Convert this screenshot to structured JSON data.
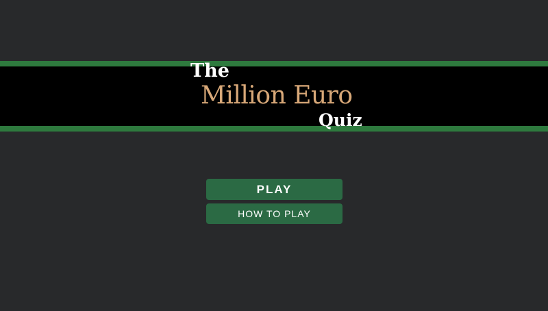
{
  "title": {
    "line1": "The",
    "line2": "Million Euro",
    "line3": "Quiz"
  },
  "menu": {
    "play_label": "PLAY",
    "how_to_play_label": "HOW TO PLAY"
  },
  "colors": {
    "background": "#28292b",
    "banner": "#000000",
    "banner_stripe": "#2e7a3e",
    "title_accent": "#d8a878",
    "button": "#2b6a44",
    "button_text": "#ffffff"
  }
}
